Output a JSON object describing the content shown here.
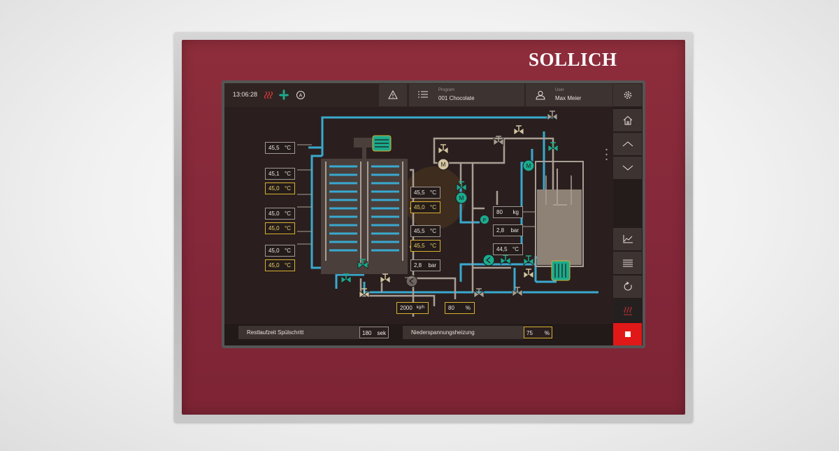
{
  "brand": "SOLLICH",
  "status": {
    "time": "13:06:28",
    "icons": [
      "heating-icon",
      "fan-icon",
      "auto-mode-icon"
    ]
  },
  "header": {
    "program_label": "Program",
    "program_value": "001 Chocolate",
    "user_label": "User",
    "user_value": "Max Meier"
  },
  "temperature_pairs": [
    {
      "actual": "45,5",
      "setpoint": "",
      "unit": "°C"
    },
    {
      "actual": "45,1",
      "setpoint": "45,0",
      "unit": "°C"
    },
    {
      "actual": "45,0",
      "setpoint": "45,0",
      "unit": "°C"
    },
    {
      "actual": "45,0",
      "setpoint": "45,0",
      "unit": "°C"
    }
  ],
  "center_values": [
    {
      "actual": "45,5",
      "setpoint": "45,0",
      "unit": "°C"
    },
    {
      "actual": "45,5",
      "setpoint": "45,5",
      "unit": "°C"
    }
  ],
  "pressure_center": {
    "value": "2,8",
    "unit": "bar"
  },
  "tank": {
    "weight": {
      "value": "80",
      "unit": "kg"
    },
    "pressure": {
      "value": "2,8",
      "unit": "bar"
    },
    "temperature": {
      "value": "44,5",
      "unit": "°C"
    }
  },
  "flow": {
    "value": "2000",
    "unit": "kg/h"
  },
  "valve_opening": {
    "value": "80",
    "unit": "%"
  },
  "sensor_letters": {
    "pump_motor": "M",
    "pressure_sensor": "P"
  },
  "footer": {
    "rinse_label": "Restlaufzeit Spülschritt",
    "rinse_value": "180",
    "rinse_unit": "sek",
    "heating_label": "Niederspannungsheizung",
    "heating_value": "75",
    "heating_unit": "%"
  },
  "colors": {
    "frame": "#84283a",
    "screen_bg": "#2a1f1e",
    "pipe_blue": "#39a9cf",
    "pipe_tan": "#a89f94",
    "valve_green": "#1bab8e",
    "setpoint_yellow": "#d9b030",
    "stop_red": "#e02020"
  },
  "nav": [
    "home-icon",
    "chevron-up-icon",
    "chevron-down-icon",
    "chart-icon",
    "list-icon",
    "refresh-icon",
    "heat-icon",
    "stop-icon"
  ]
}
